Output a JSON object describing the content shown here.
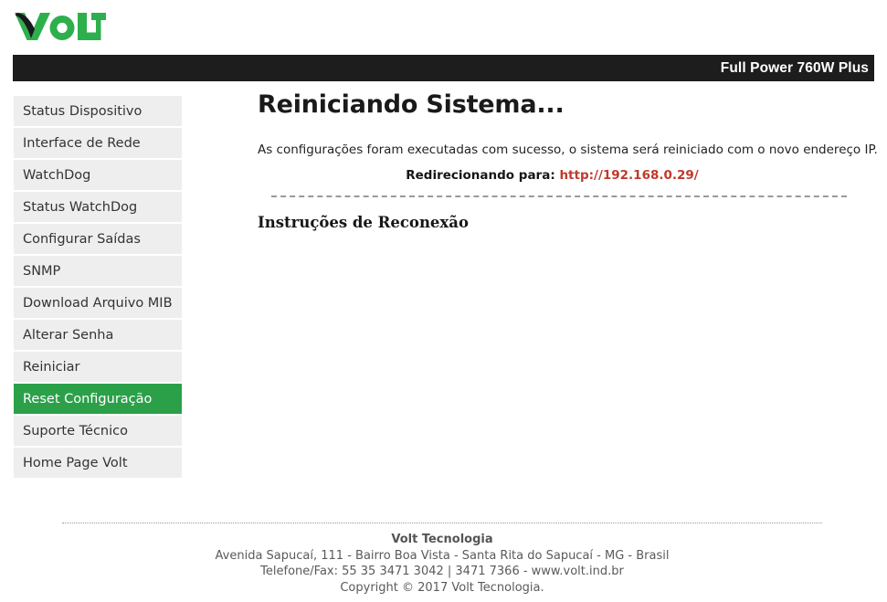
{
  "brand": {
    "logo_text": "VOLT",
    "logo_green": "#2eaf4e",
    "logo_dark": "#1a1a1a"
  },
  "titlebar": {
    "model": "Full Power 760W Plus",
    "background": "#1d1d1d",
    "text_color": "#ffffff"
  },
  "sidebar": {
    "active_index": 9,
    "active_color": "#2ba049",
    "items": [
      {
        "label": "Status Dispositivo"
      },
      {
        "label": "Interface de Rede"
      },
      {
        "label": "WatchDog"
      },
      {
        "label": "Status WatchDog"
      },
      {
        "label": "Configurar Saídas"
      },
      {
        "label": "SNMP"
      },
      {
        "label": "Download Arquivo MIB"
      },
      {
        "label": "Alterar Senha"
      },
      {
        "label": "Reiniciar"
      },
      {
        "label": "Reset Configuração"
      },
      {
        "label": "Suporte Técnico"
      },
      {
        "label": "Home Page Volt"
      }
    ]
  },
  "main": {
    "title": "Reiniciando Sistema...",
    "message": "As configurações foram executadas com sucesso, o sistema será reiniciado com o novo endereço IP.",
    "redirect_label": "Redirecionando para:",
    "redirect_url": "http://192.168.0.29/",
    "redirect_url_color": "#c0392b",
    "subheading": "Instruções de Reconexão"
  },
  "footer": {
    "company": "Volt Tecnologia",
    "address": "Avenida Sapucaí, 111 - Bairro Boa Vista - Santa Rita do Sapucaí - MG - Brasil",
    "contact": "Telefone/Fax: 55 35 3471 3042 | 3471 7366 - www.volt.ind.br",
    "copyright": "Copyright © 2017 Volt Tecnologia."
  }
}
